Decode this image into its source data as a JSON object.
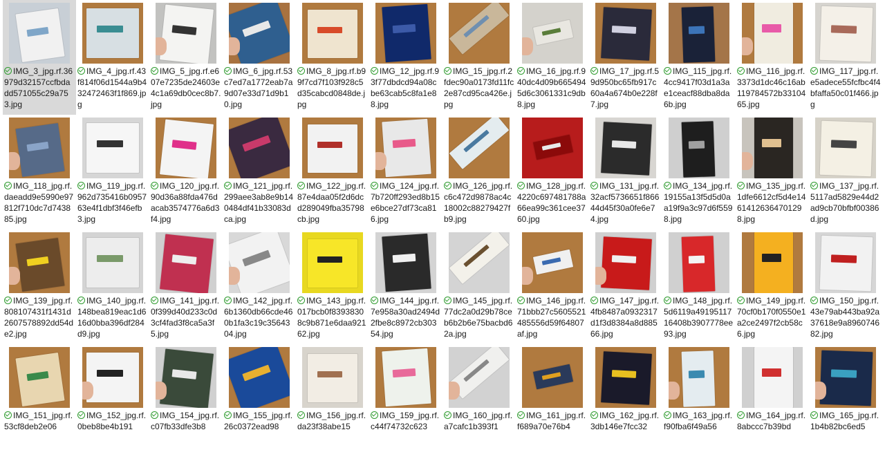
{
  "files": [
    {
      "name": "IMG_3_jpg.rf.36979d32157ccfbdadd571055c29a753.jpg",
      "bg": "#c8cfd6",
      "book": "#f1f1f1",
      "accent": "#7fa6c8",
      "selected": true
    },
    {
      "name": "IMG_4_jpg.rf.43f814f06d1544a9b432472463f1f869.jpg",
      "bg": "#b07a3f",
      "book": "#d7dfe3",
      "accent": "#3a8d92"
    },
    {
      "name": "IMG_5_jpg.rf.e607e7235de24603e4c1a69db0cec8b7.jpg",
      "bg": "#c2c2c0",
      "book": "#f4f4f2",
      "accent": "#333333"
    },
    {
      "name": "IMG_6_jpg.rf.53c7ed7a1772eab7a9d07e33d71d9b10.jpg",
      "bg": "#a87240",
      "book": "#2f5f8f",
      "accent": "#e8e8e8"
    },
    {
      "name": "IMG_8_jpg.rf.b99f7cd7f103f928c5d35cabcd0848de.jpg",
      "bg": "#b07a3f",
      "book": "#efe4cf",
      "accent": "#d84b2a"
    },
    {
      "name": "IMG_12_jpg.rf.93f77dbdcd94a08cbe63cab5c8fa1e88.jpg",
      "bg": "#b07a3f",
      "book": "#10296a",
      "accent": "#3c5aa8"
    },
    {
      "name": "IMG_15_jpg.rf.2fdec90a0173fd11fc2e87cd95ca426e.jpg",
      "bg": "#b07a3f",
      "book": "#c9b79a",
      "accent": "#6f8fb0"
    },
    {
      "name": "IMG_16_jpg.rf.940dc4d09b6654945d6c3061331c9db8.jpg",
      "bg": "#d4d2cc",
      "book": "#e9e7e1",
      "accent": "#5a7d3a"
    },
    {
      "name": "IMG_17_jpg.rf.59d950bc65fb917c60a4a674b0e228f7.jpg",
      "bg": "#b07a3f",
      "book": "#2a2a3a",
      "accent": "#d0d0e0"
    },
    {
      "name": "IMG_115_jpg.rf.4cc9417f03d1a3ae1ceacf88dba8da6b.jpg",
      "bg": "#a47549",
      "book": "#1a2238",
      "accent": "#3c74b8"
    },
    {
      "name": "IMG_116_jpg.rf.3373d1dc46c16ab119784572b3310465.jpg",
      "bg": "#b07a3f",
      "book": "#f0ece0",
      "accent": "#e85aa8"
    },
    {
      "name": "IMG_117_jpg.rf.e5adece55fcfbc4f4bfaffa50c01f466.jpg",
      "bg": "#d6d4cf",
      "book": "#f4f0e8",
      "accent": "#a86a5a"
    },
    {
      "name": "IMG_118_jpg.rf.daeadd9e5990e97812f710dc7d743885.jpg",
      "bg": "#b07a3f",
      "book": "#566a88",
      "accent": "#8aa4c8"
    },
    {
      "name": "IMG_119_jpg.rf.962d735416b095763e4f1dbf3f46efb3.jpg",
      "bg": "#d6d6d6",
      "book": "#f6f6f6",
      "accent": "#333333"
    },
    {
      "name": "IMG_120_jpg.rf.90d36a88fda476dacab3574776a6d3f4.jpg",
      "bg": "#b07a3f",
      "book": "#f4f4f4",
      "accent": "#e0308a"
    },
    {
      "name": "IMG_121_jpg.rf.299aee3ab8e9b140484df41b33083dca.jpg",
      "bg": "#b07a3f",
      "book": "#3a2a40",
      "accent": "#c83a6a"
    },
    {
      "name": "IMG_122_jpg.rf.87e4daa05f2d6dcd289049fba35798cb.jpg",
      "bg": "#b07a3f",
      "book": "#f2f2f2",
      "accent": "#b0302a"
    },
    {
      "name": "IMG_124_jpg.rf.7b720ff293ed8b15e6bce27df73ca816.jpg",
      "bg": "#b07a3f",
      "book": "#e8e8e8",
      "accent": "#e85a8a"
    },
    {
      "name": "IMG_126_jpg.rf.c6c472d9878ac4c18002c88279427fb9.jpg",
      "bg": "#b07a3f",
      "book": "#e4ecef",
      "accent": "#4a7aa0"
    },
    {
      "name": "IMG_128_jpg.rf.4220c697481788a66ea99c361cee3760.jpg",
      "bg": "#b71c1c",
      "book": "#8b0a0a",
      "accent": "#e8e8e8"
    },
    {
      "name": "IMG_131_jpg.rf.32acf5736651f86644d45f30a0fe6e74.jpg",
      "bg": "#d8d6d2",
      "book": "#2b2b2b",
      "accent": "#e8e8e8"
    },
    {
      "name": "IMG_134_jpg.rf.19155a13f5d5d0aa19f9a3c97d6f5598.jpg",
      "bg": "#cfcfcf",
      "book": "#1e1e1e",
      "accent": "#a0a0a0"
    },
    {
      "name": "IMG_135_jpg.rf.1dfe6612cf5d4e14614126364701298.jpg",
      "bg": "#c8c4bd",
      "book": "#2a2622",
      "accent": "#e0c090"
    },
    {
      "name": "IMG_137_jpg.rf.5117ad5829e44d2ad9cb70bfbf00386d.jpg",
      "bg": "#d6d2c8",
      "book": "#f4f0e4",
      "accent": "#444444"
    },
    {
      "name": "IMG_139_jpg.rf.808107431f1431d2607578892dd54de2.jpg",
      "bg": "#b07a3f",
      "book": "#6a4a2a",
      "accent": "#f0d020"
    },
    {
      "name": "IMG_140_jpg.rf.148bea819eac1d616d0bba396df284d9.jpg",
      "bg": "#d4d4d4",
      "book": "#ededed",
      "accent": "#7a9a6a"
    },
    {
      "name": "IMG_141_jpg.rf.0f399d40d233c0d3cf4fad3f8ca5a3f5.jpg",
      "bg": "#d0d0d0",
      "book": "#c03050",
      "accent": "#eeeeee"
    },
    {
      "name": "IMG_142_jpg.rf.6b1360db66cde460b1fa3c19c3564304.jpg",
      "bg": "#d8d8d8",
      "book": "#f2f2f2",
      "accent": "#888888"
    },
    {
      "name": "IMG_143_jpg.rf.017bcb0f83938308c9b871e6daa92162.jpg",
      "bg": "#e8d820",
      "book": "#f7e628",
      "accent": "#222222"
    },
    {
      "name": "IMG_144_jpg.rf.7e958a30ad2494d2fbe8c8972cb30354.jpg",
      "bg": "#d4d4d4",
      "book": "#2a2a2a",
      "accent": "#f0f0f0"
    },
    {
      "name": "IMG_145_jpg.rf.77dc2a0d29b78ceb6b2b6e75bacbd62a.jpg",
      "bg": "#d4d4d4",
      "book": "#f3f1ea",
      "accent": "#6a5030"
    },
    {
      "name": "IMG_146_jpg.rf.71bbb27c5605521485556d59f64807af.jpg",
      "bg": "#b07a3f",
      "book": "#f0f0f0",
      "accent": "#3a6ab0"
    },
    {
      "name": "IMG_147_jpg.rf.4fb8487a0932317d1f3d8384a8d88566.jpg",
      "bg": "#d0d0d0",
      "book": "#c81a1a",
      "accent": "#f0f0f0"
    },
    {
      "name": "IMG_148_jpg.rf.5d6119a4919511716408b3907778ee93.jpg",
      "bg": "#d0d0d0",
      "book": "#d8282a",
      "accent": "#f4f4f4"
    },
    {
      "name": "IMG_149_jpg.rf.70cf0b170f0550e1a2ce2497f2cb58c6.jpg",
      "bg": "#b07a3f",
      "book": "#f4b020",
      "accent": "#222222"
    },
    {
      "name": "IMG_150_jpg.rf.43e79ab443ba92a37618e9a896074682.jpg",
      "bg": "#d6d6d6",
      "book": "#f2f2f2",
      "accent": "#c02020"
    },
    {
      "name": "IMG_151_jpg.rf.53cf8deb2e06",
      "bg": "#b07a3f",
      "book": "#e8d6b0",
      "accent": "#3a8a4a"
    },
    {
      "name": "IMG_152_jpg.rf.0beb8be4b191",
      "bg": "#b07a3f",
      "book": "#f4f4f4",
      "accent": "#222222"
    },
    {
      "name": "IMG_154_jpg.rf.c07fb33dfe3b8",
      "bg": "#d0d0d0",
      "book": "#3a4a3a",
      "accent": "#e8e8e8"
    },
    {
      "name": "IMG_155_jpg.rf.26c0372ead98",
      "bg": "#b07a3f",
      "book": "#1a4a9a",
      "accent": "#e8b030"
    },
    {
      "name": "IMG_156_jpg.rf.da23f38abe15",
      "bg": "#d8d4cc",
      "book": "#f2ede4",
      "accent": "#a07050"
    },
    {
      "name": "IMG_159_jpg.rf.c44f74732c623",
      "bg": "#b07a3f",
      "book": "#eef2ec",
      "accent": "#e86a9a"
    },
    {
      "name": "IMG_160_jpg.rf.a7cafc1b393f1",
      "bg": "#d2d2d2",
      "book": "#f0f0ee",
      "accent": "#888888"
    },
    {
      "name": "IMG_161_jpg.rf.f689a70e76b4",
      "bg": "#b07a3f",
      "book": "#2a3a5a",
      "accent": "#e0a020"
    },
    {
      "name": "IMG_162_jpg.rf.3db146e7fcc32",
      "bg": "#b07a3f",
      "book": "#1a1a2a",
      "accent": "#e8c020"
    },
    {
      "name": "IMG_163_jpg.rf.f90fba6f49a56",
      "bg": "#b07a3f",
      "book": "#e4ecf0",
      "accent": "#3a8ab0"
    },
    {
      "name": "IMG_164_jpg.rf.8abccc7b39bd",
      "bg": "#d0d0d0",
      "book": "#f4f4f4",
      "accent": "#d03030"
    },
    {
      "name": "IMG_165_jpg.rf.1b4b82bc6ed5",
      "bg": "#b07a3f",
      "book": "#1a2a4a",
      "accent": "#3aa0c0"
    }
  ]
}
